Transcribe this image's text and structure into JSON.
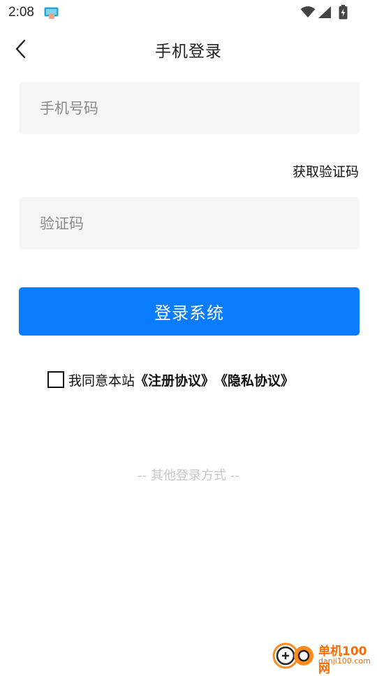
{
  "status_bar": {
    "time": "2:08",
    "app_icon": "tablet-app-icon",
    "wifi_icon": "wifi-icon",
    "signal_icon": "cellular-signal-icon",
    "battery_icon": "battery-charging-icon"
  },
  "header": {
    "title": "手机登录",
    "back_icon": "chevron-left-icon"
  },
  "form": {
    "phone_placeholder": "手机号码",
    "phone_value": "",
    "get_code_label": "获取验证码",
    "code_placeholder": "验证码",
    "code_value": "",
    "login_label": "登录系统"
  },
  "agreement": {
    "checked": false,
    "text": "我同意本站",
    "terms_link": "《注册协议》",
    "privacy_link": "《隐私协议》"
  },
  "other_login": {
    "label": "-- 其他登录方式 --"
  },
  "watermark": {
    "name": "单机100网",
    "url": "danji100.com"
  },
  "colors": {
    "primary": "#0a7cff",
    "input_bg": "#f5f5f5",
    "muted": "#c6c6c6",
    "watermark": "#ff6a00"
  }
}
